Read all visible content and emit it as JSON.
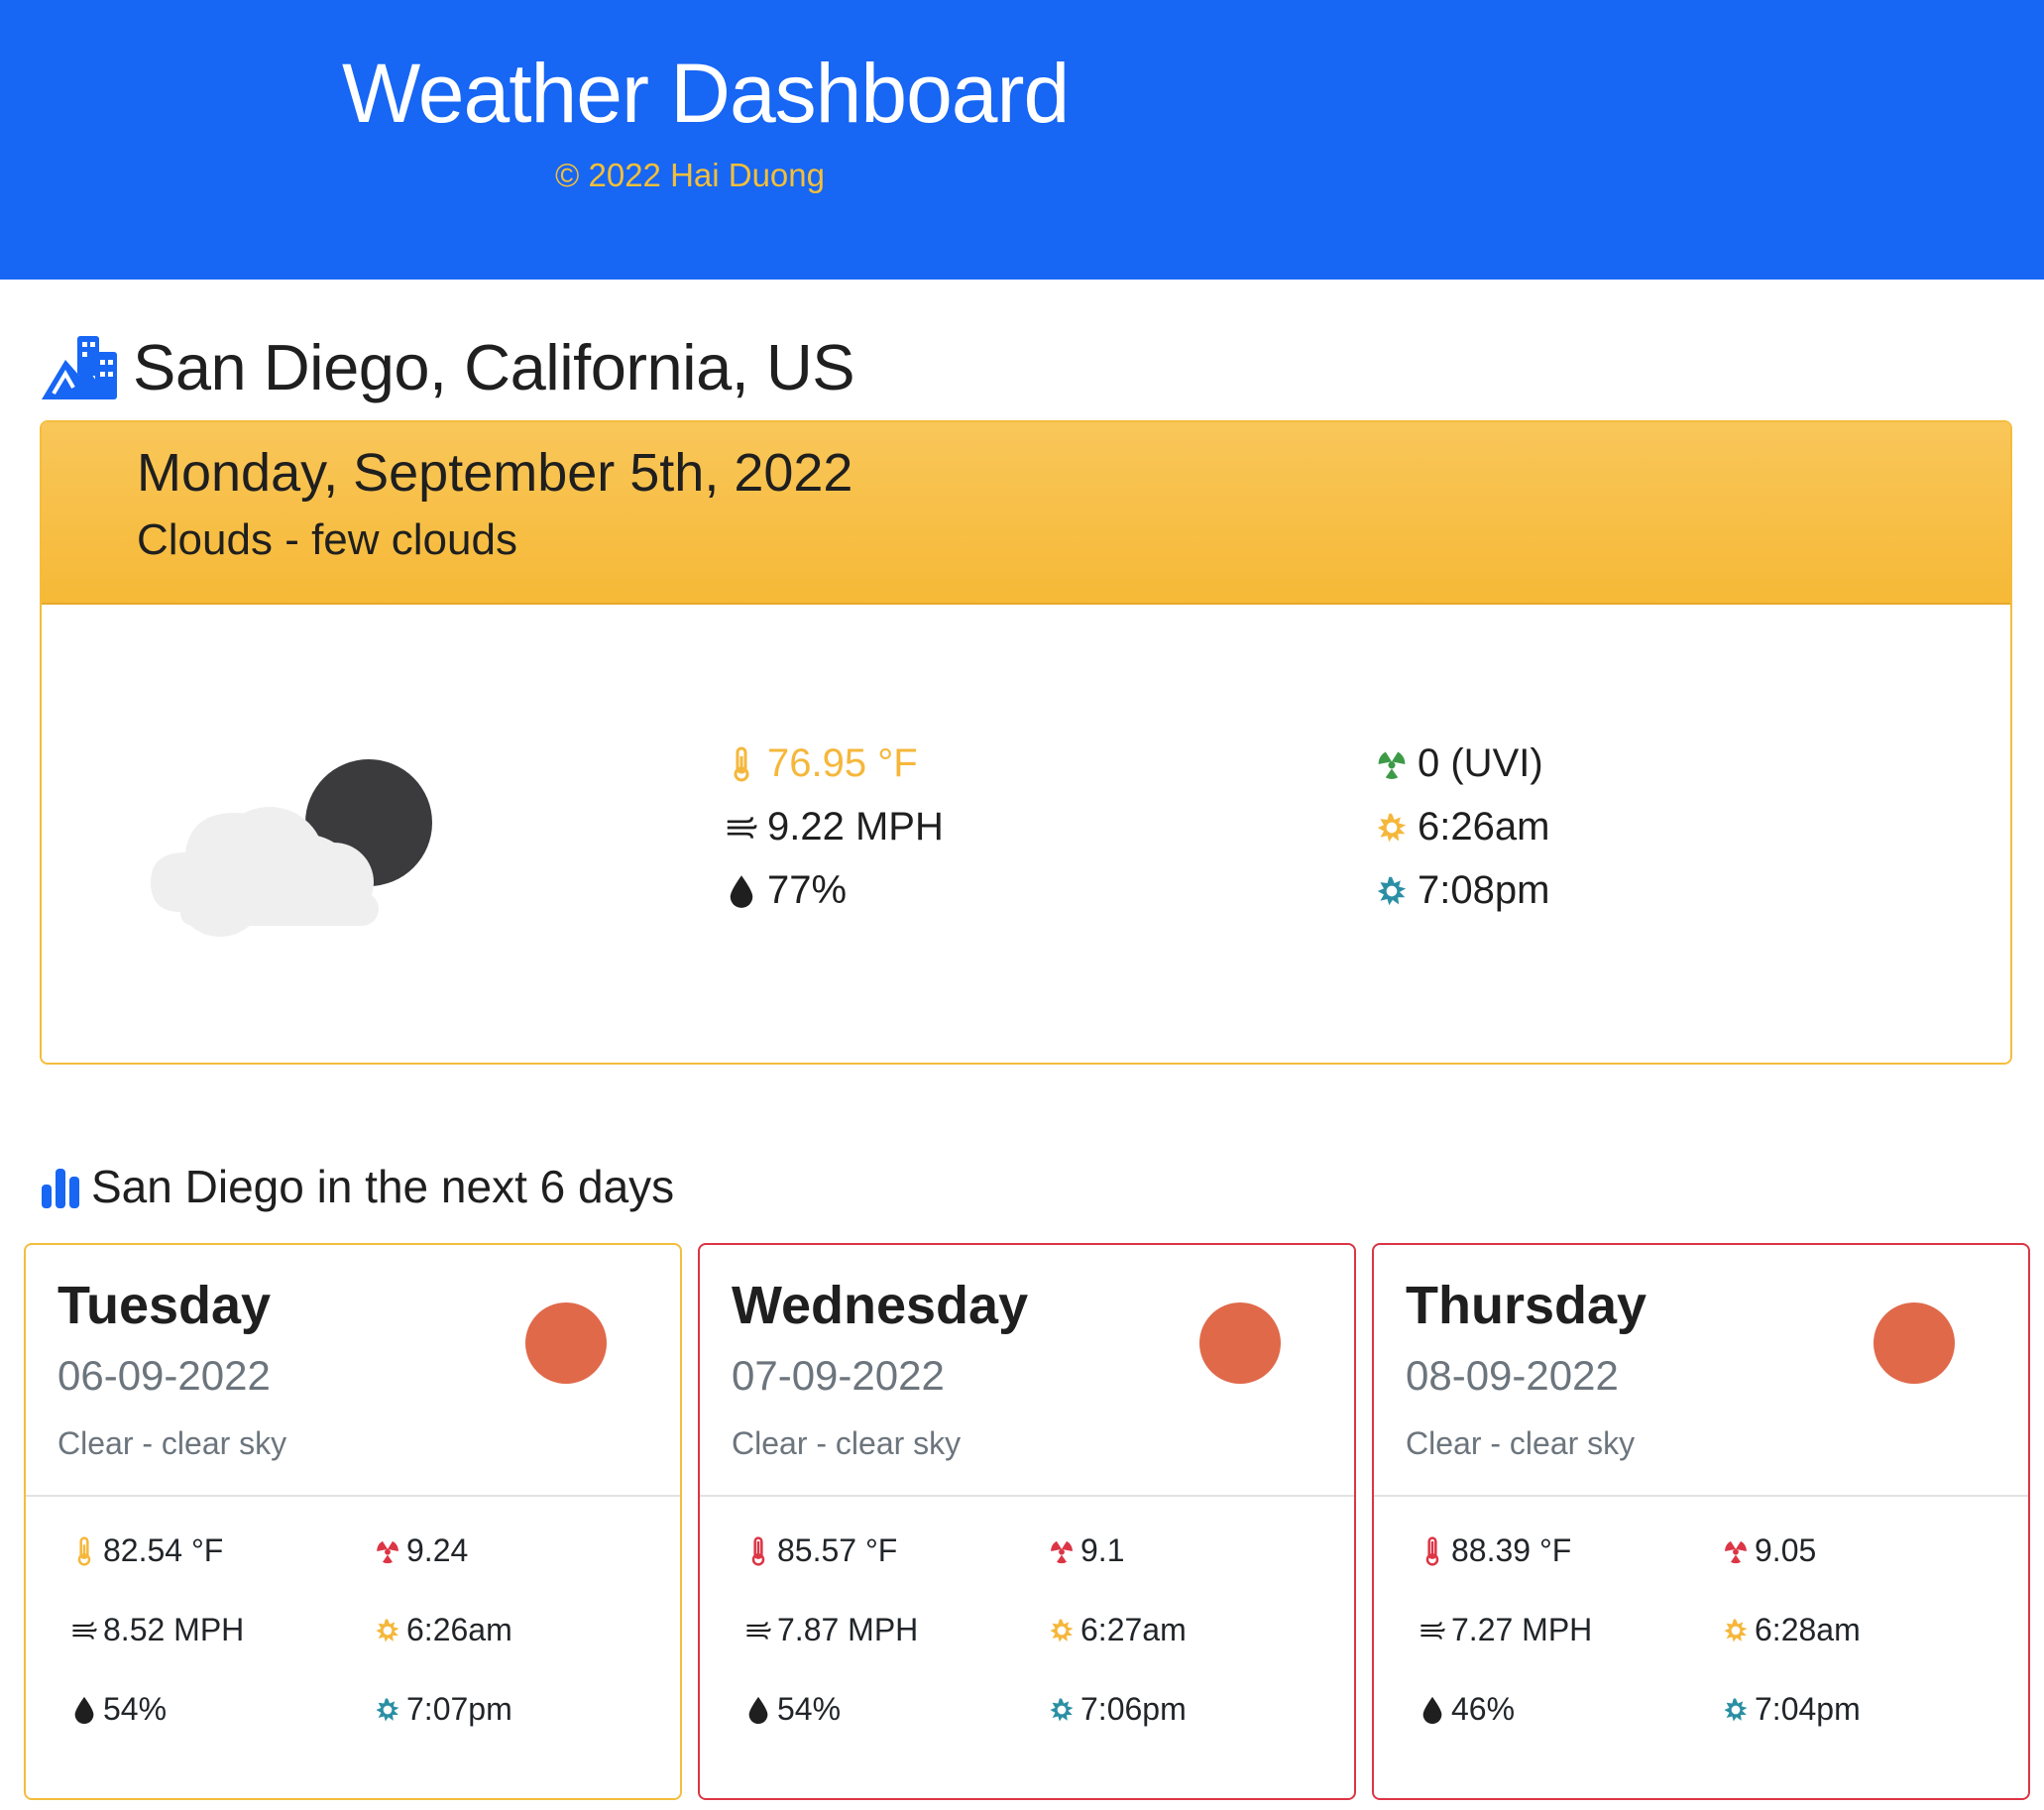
{
  "header": {
    "title": "Weather Dashboard",
    "copyright": "© 2022 Hai Duong"
  },
  "location": {
    "name": "San Diego, California, US",
    "icon": "city-icon"
  },
  "current": {
    "date": "Monday, September 5th, 2022",
    "condition": "Clouds - few clouds",
    "icon": "cloud-moon-icon",
    "temperature": "76.95 °F",
    "wind": "9.22 MPH",
    "humidity": "77%",
    "uvi": "0 (UVI)",
    "sunrise": "6:26am",
    "sunset": "7:08pm"
  },
  "forecast": {
    "title": "San Diego in the next 6 days",
    "days": [
      {
        "day": "Tuesday",
        "date": "06-09-2022",
        "desc": "Clear - clear sky",
        "temp": "82.54 °F",
        "wind": "8.52 MPH",
        "humidity": "54%",
        "uvi": "9.24",
        "sunrise": "6:26am",
        "sunset": "7:07pm"
      },
      {
        "day": "Wednesday",
        "date": "07-09-2022",
        "desc": "Clear - clear sky",
        "temp": "85.57 °F",
        "wind": "7.87 MPH",
        "humidity": "54%",
        "uvi": "9.1",
        "sunrise": "6:27am",
        "sunset": "7:06pm"
      },
      {
        "day": "Thursday",
        "date": "08-09-2022",
        "desc": "Clear - clear sky",
        "temp": "88.39 °F",
        "wind": "7.27 MPH",
        "humidity": "46%",
        "uvi": "9.05",
        "sunrise": "6:28am",
        "sunset": "7:04pm"
      }
    ]
  },
  "colors": {
    "header_bg": "#1766f4",
    "accent_yellow": "#f5bd3c",
    "danger_red": "#dc3545",
    "sun_orange": "#e0694a",
    "uv_green": "#3d9a47",
    "sunset_teal": "#2a8fa4"
  }
}
